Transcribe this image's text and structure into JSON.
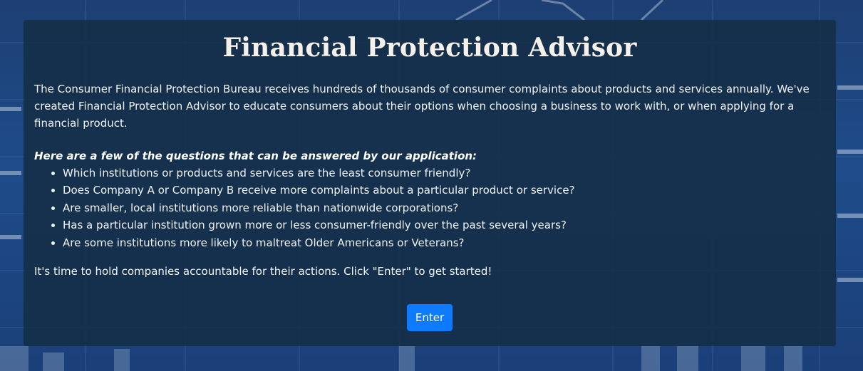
{
  "title": "Financial Protection Advisor",
  "intro": "The Consumer Financial Protection Bureau receives hundreds of thousands of consumer complaints about products and services annually. We've created Financial Protection Advisor to educate consumers about their options when choosing a business to work with, or when applying for a financial product.",
  "questions_heading": "Here are a few of the questions that can be answered by our application:",
  "questions": [
    "Which institutions or products and services are the least consumer friendly?",
    "Does Company A or Company B receive more complaints about a particular product or service?",
    "Are smaller, local institutions more reliable than nationwide corporations?",
    "Has a particular institution grown more or less consumer-friendly over the past several years?",
    "Are some institutions more likely to maltreat Older Americans or Veterans?"
  ],
  "cta": "It's time to hold companies accountable for their actions. Click \"Enter\" to get started!",
  "enter_label": "Enter",
  "colors": {
    "button": "#0d7bff",
    "card": "#142d46",
    "background": "#1e4c8a"
  }
}
